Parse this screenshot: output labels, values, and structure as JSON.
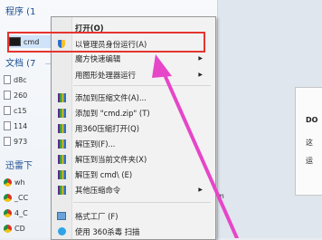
{
  "start_menu": {
    "group_programs": "程序 (1",
    "cmd_item": "cmd",
    "group_documents": "文档 (7",
    "documents": [
      "d8c",
      "260",
      "c15",
      "114",
      "973"
    ],
    "group_xunlei": "迅雷下",
    "xunlei_items": [
      "wh",
      "_CC",
      "4_C",
      "CD"
    ]
  },
  "context_menu": {
    "items": [
      {
        "label": "打开(O)",
        "bold": true,
        "icon": "none"
      },
      {
        "label": "以管理员身份运行(A)",
        "icon": "shield-icon"
      },
      {
        "label": "魔方快速编辑",
        "submenu": true,
        "icon": "none"
      },
      {
        "label": "用图形处理器运行",
        "submenu": true,
        "icon": "none"
      },
      {
        "label": "添加到压缩文件(A)...",
        "icon": "archive-icon"
      },
      {
        "label": "添加到 \"cmd.zip\" (T)",
        "icon": "archive-icon"
      },
      {
        "label": "用360压缩打开(Q)",
        "icon": "archive-icon"
      },
      {
        "label": "解压到(F)...",
        "icon": "archive-icon"
      },
      {
        "label": "解压到当前文件夹(X)",
        "icon": "archive-icon"
      },
      {
        "label": "解压到 cmd\\ (E)",
        "icon": "archive-icon"
      },
      {
        "label": "其他压缩命令",
        "submenu": true,
        "icon": "archive-icon"
      },
      {
        "label": "格式工厂 (F)",
        "icon": "format-factory-icon"
      },
      {
        "label": "使用 360杀毒 扫描",
        "icon": "antivirus-icon"
      }
    ]
  },
  "background": {
    "frag_do": "DO",
    "frag_zhe": "这",
    "frag_yun": "运",
    "frag_m": "m"
  },
  "colors": {
    "highlight_border": "#e5352f",
    "arrow": "#e646c8"
  }
}
